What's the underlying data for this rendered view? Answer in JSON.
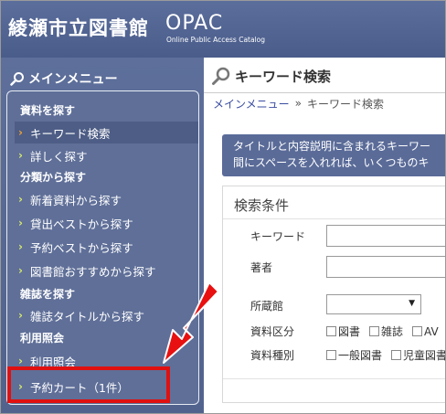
{
  "header": {
    "library_name": "綾瀬市立図書館",
    "opac_title": "OPAC",
    "opac_subtitle": "Online Public Access Catalog"
  },
  "sidebar": {
    "title": "メインメニュー",
    "categories": [
      {
        "label": "資料を探す"
      },
      {
        "label": "分類から探す"
      },
      {
        "label": "雑誌を探す"
      },
      {
        "label": "利用照会"
      }
    ],
    "items": [
      {
        "label": "キーワード検索",
        "active": true
      },
      {
        "label": "詳しく探す"
      },
      {
        "label": "新着資料から探す"
      },
      {
        "label": "貸出ベストから探す"
      },
      {
        "label": "予約ベストから探す"
      },
      {
        "label": "図書館おすすめから探す"
      },
      {
        "label": "雑誌タイトルから探す"
      },
      {
        "label": "利用照会"
      },
      {
        "label": "予約カート（1件）"
      }
    ]
  },
  "main": {
    "page_title": "キーワード検索",
    "breadcrumb": {
      "home": "メインメニュー",
      "separator": "»",
      "current": "キーワード検索"
    },
    "info_text_line1": "タイトルと内容説明に含まれるキーワー",
    "info_text_line2": "間にスペースを入れれば、いくつものキ",
    "conditions": {
      "heading": "検索条件",
      "keyword_label": "キーワード",
      "author_label": "著者",
      "library_label": "所蔵館",
      "library_value": "",
      "material_type_label": "資料区分",
      "material_type_options": [
        "図書",
        "雑誌",
        "AV"
      ],
      "material_kind_label": "資料種別",
      "material_kind_options": [
        "一般図書",
        "児童図書"
      ]
    }
  },
  "colors": {
    "header_bg": "#4a5c8a",
    "sidebar_bg": "#5d6f9a",
    "highlight": "#e01010",
    "chevron": "#d6e86a"
  }
}
